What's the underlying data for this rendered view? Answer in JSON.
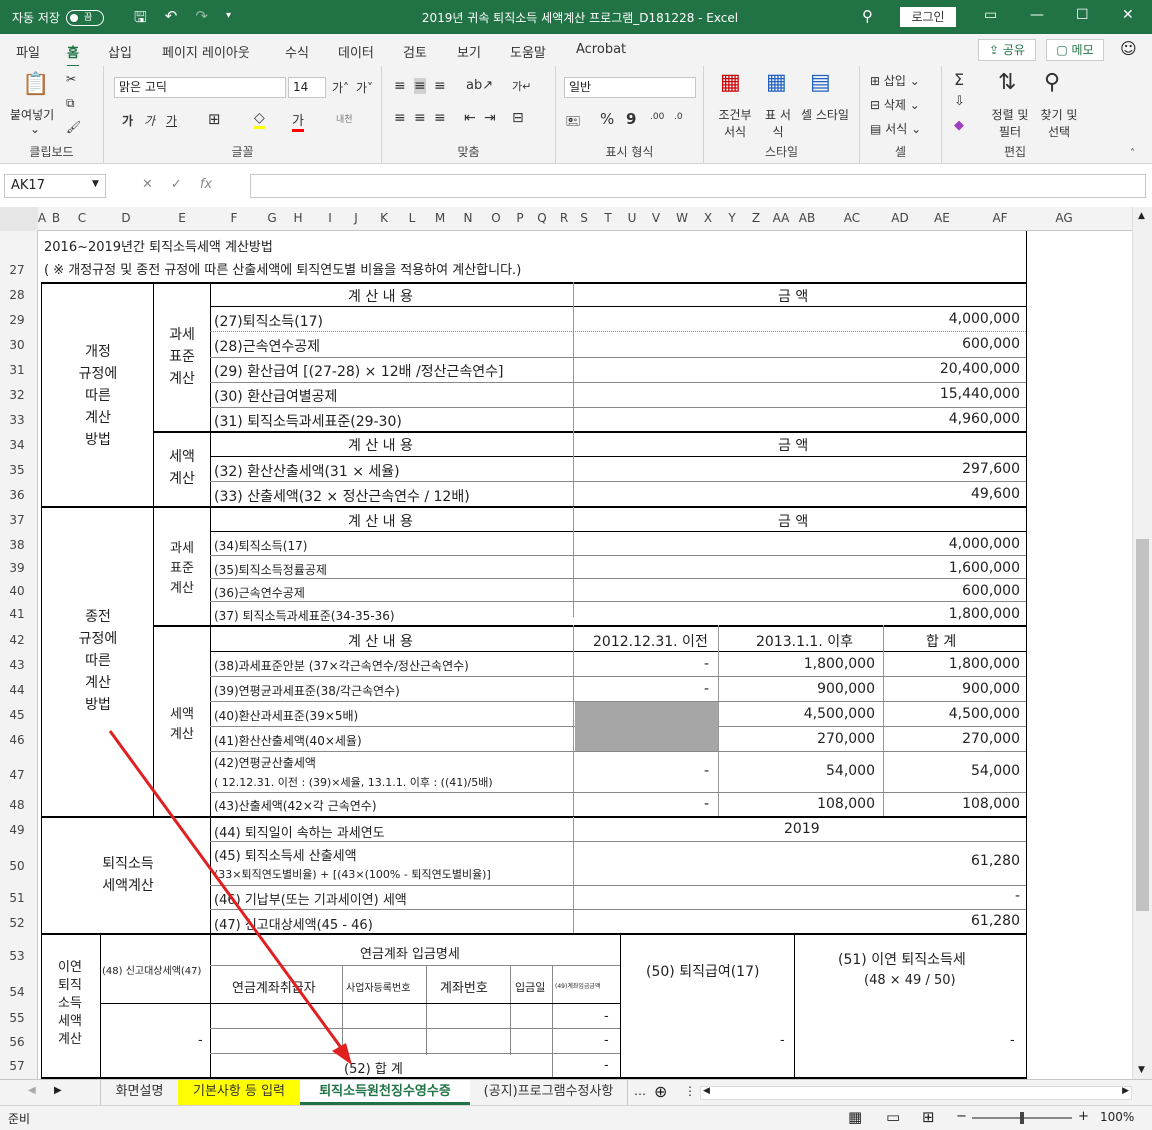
{
  "titlebar": {
    "autosave": "자동 저장",
    "toggle": "끔",
    "title": "2019년 귀속 퇴직소득 세액계산 프로그램_D181228  -  Excel",
    "login": "로그인"
  },
  "tabs": [
    "파일",
    "홈",
    "삽입",
    "페이지 레이아웃",
    "수식",
    "데이터",
    "검토",
    "보기",
    "도움말",
    "Acrobat"
  ],
  "share": "공유",
  "memo": "메모",
  "ribbon": {
    "paste": "붙여넣기",
    "clipboard": "클립보드",
    "font_name": "맑은 고딕",
    "font_size": "14",
    "font_grp": "글꼴",
    "align_grp": "맞춤",
    "num_format": "일반",
    "num_grp": "표시 형식",
    "cond_fmt": "조건부 서식",
    "table_fmt": "표 서식",
    "cell_style": "셀 스타일",
    "style_grp": "스타일",
    "insert": "삽입",
    "delete": "삭제",
    "format": "서식",
    "cell_grp": "셀",
    "sort": "정렬 및 필터",
    "find": "찾기 및 선택",
    "edit_grp": "편집"
  },
  "namebox": "AK17",
  "columns": [
    "A",
    "B",
    "C",
    "D",
    "E",
    "F",
    "G",
    "H",
    "I",
    "J",
    "K",
    "L",
    "M",
    "N",
    "O",
    "P",
    "Q",
    "R",
    "S",
    "T",
    "U",
    "V",
    "W",
    "X",
    "Y",
    "Z",
    "AA",
    "AB",
    "AC",
    "AD",
    "AE",
    "AF",
    "AG"
  ],
  "rows": [
    "27",
    "28",
    "29",
    "30",
    "31",
    "32",
    "33",
    "34",
    "35",
    "36",
    "37",
    "38",
    "39",
    "40",
    "41",
    "42",
    "43",
    "44",
    "45",
    "46",
    "47",
    "48",
    "49",
    "50",
    "51",
    "52",
    "53",
    "54",
    "55",
    "56",
    "57"
  ],
  "sheet": {
    "title1": "2016~2019년간 퇴직소득세액 계산방법",
    "title2": "( ※ 개정규정 및 종전 규정에 따른 산출세액에 퇴직연도별 비율을 적용하여 계산합니다.)",
    "sec1": "개정\n규정에\n따른\n계산\n방법",
    "sub1a": "과세\n표준\n계산",
    "sub1b": "세액\n계산",
    "hdr_item": "계 산 내 용",
    "hdr_amt": "금    액",
    "r29": "(27)퇴직소득(17)",
    "v29": "4,000,000",
    "r30": "(28)근속연수공제",
    "v30": "600,000",
    "r31": "(29) 환산급여 [(27-28) × 12배 /정산근속연수]",
    "v31": "20,400,000",
    "r32": "(30) 환산급여별공제",
    "v32": "15,440,000",
    "r33": "(31) 퇴직소득과세표준(29-30)",
    "v33": "4,960,000",
    "r35": "(32) 환산산출세액(31 × 세율)",
    "v35": "297,600",
    "r36": "(33) 산출세액(32 × 정산근속연수 / 12배)",
    "v36": "49,600",
    "sec2": "종전\n규정에\n따른\n계산\n방법",
    "sub2a": "과세\n표준\n계산",
    "sub2b": "세액\n계산",
    "r38": "(34)퇴직소득(17)",
    "v38": "4,000,000",
    "r39": "(35)퇴직소득정률공제",
    "v39": "1,600,000",
    "r40": "(36)근속연수공제",
    "v40": "600,000",
    "r41": "(37) 퇴직소득과세표준(34-35-36)",
    "v41": "1,800,000",
    "h42a": "2012.12.31. 이전",
    "h42b": "2013.1.1. 이후",
    "h42c": "합    계",
    "r43": "(38)과세표준안분 (37×각근속연수/정산근속연수)",
    "a43": "-",
    "b43": "1,800,000",
    "c43": "1,800,000",
    "r44": "(39)연평균과세표준(38/각근속연수)",
    "a44": "-",
    "b44": "900,000",
    "c44": "900,000",
    "r45": "(40)환산과세표준(39×5배)",
    "b45": "4,500,000",
    "c45": "4,500,000",
    "r46": "(41)환산산출세액(40×세율)",
    "b46": "270,000",
    "c46": "270,000",
    "r47a": "(42)연평균산출세액",
    "r47b": "( 12.12.31. 이전 : (39)×세율, 13.1.1. 이후 : ((41)/5배)",
    "a47": "-",
    "b47": "54,000",
    "c47": "54,000",
    "r48": "(43)산출세액(42×각 근속연수)",
    "a48": "-",
    "b48": "108,000",
    "c48": "108,000",
    "sec3": "퇴직소득\n세액계산",
    "r49": "(44) 퇴직일이 속하는 과세연도",
    "v49": "2019",
    "r50a": "(45) 퇴직소득세 산출세액",
    "r50b": "(33×퇴직연도별비율) + [(43×(100% - 퇴직연도별비율)]",
    "v50": "61,280",
    "r51": "(46) 기납부(또는 기과세이연) 세액",
    "v51": "-",
    "r52": "(47) 신고대상세액(45 - 46)",
    "v52": "61,280",
    "sec4": "이연\n퇴직\n소득\n세액\n계산",
    "h53a": "(48) 신고대상세액(47)",
    "h53b": "연금계좌 입금명세",
    "h53c": "(50) 퇴직급여(17)",
    "h53d": "(51) 이연 퇴직소득세",
    "h53e": "(48 × 49 / 50)",
    "h54a": "연금계좌취급자",
    "h54b": "사업자등록번호",
    "h54c": "계좌번호",
    "h54d": "입금일",
    "h54e": "(49)계좌입금금액",
    "d55": "-",
    "d56": "-",
    "d56b": "-",
    "d56c": "-",
    "d56d": "-",
    "t57": "(52) 합    계",
    "d57": "-"
  },
  "sheettabs": [
    "화면설명",
    "기본사항 등 입력",
    "퇴직소득원천징수영수증",
    "(공지)프로그램수정사항"
  ],
  "status": {
    "ready": "준비",
    "zoom": "100%"
  },
  "colors": {
    "excel_green": "#217346",
    "yellow_tab": "#ffff00",
    "arrow": "#e02020",
    "shade": "#a6a6a6"
  }
}
